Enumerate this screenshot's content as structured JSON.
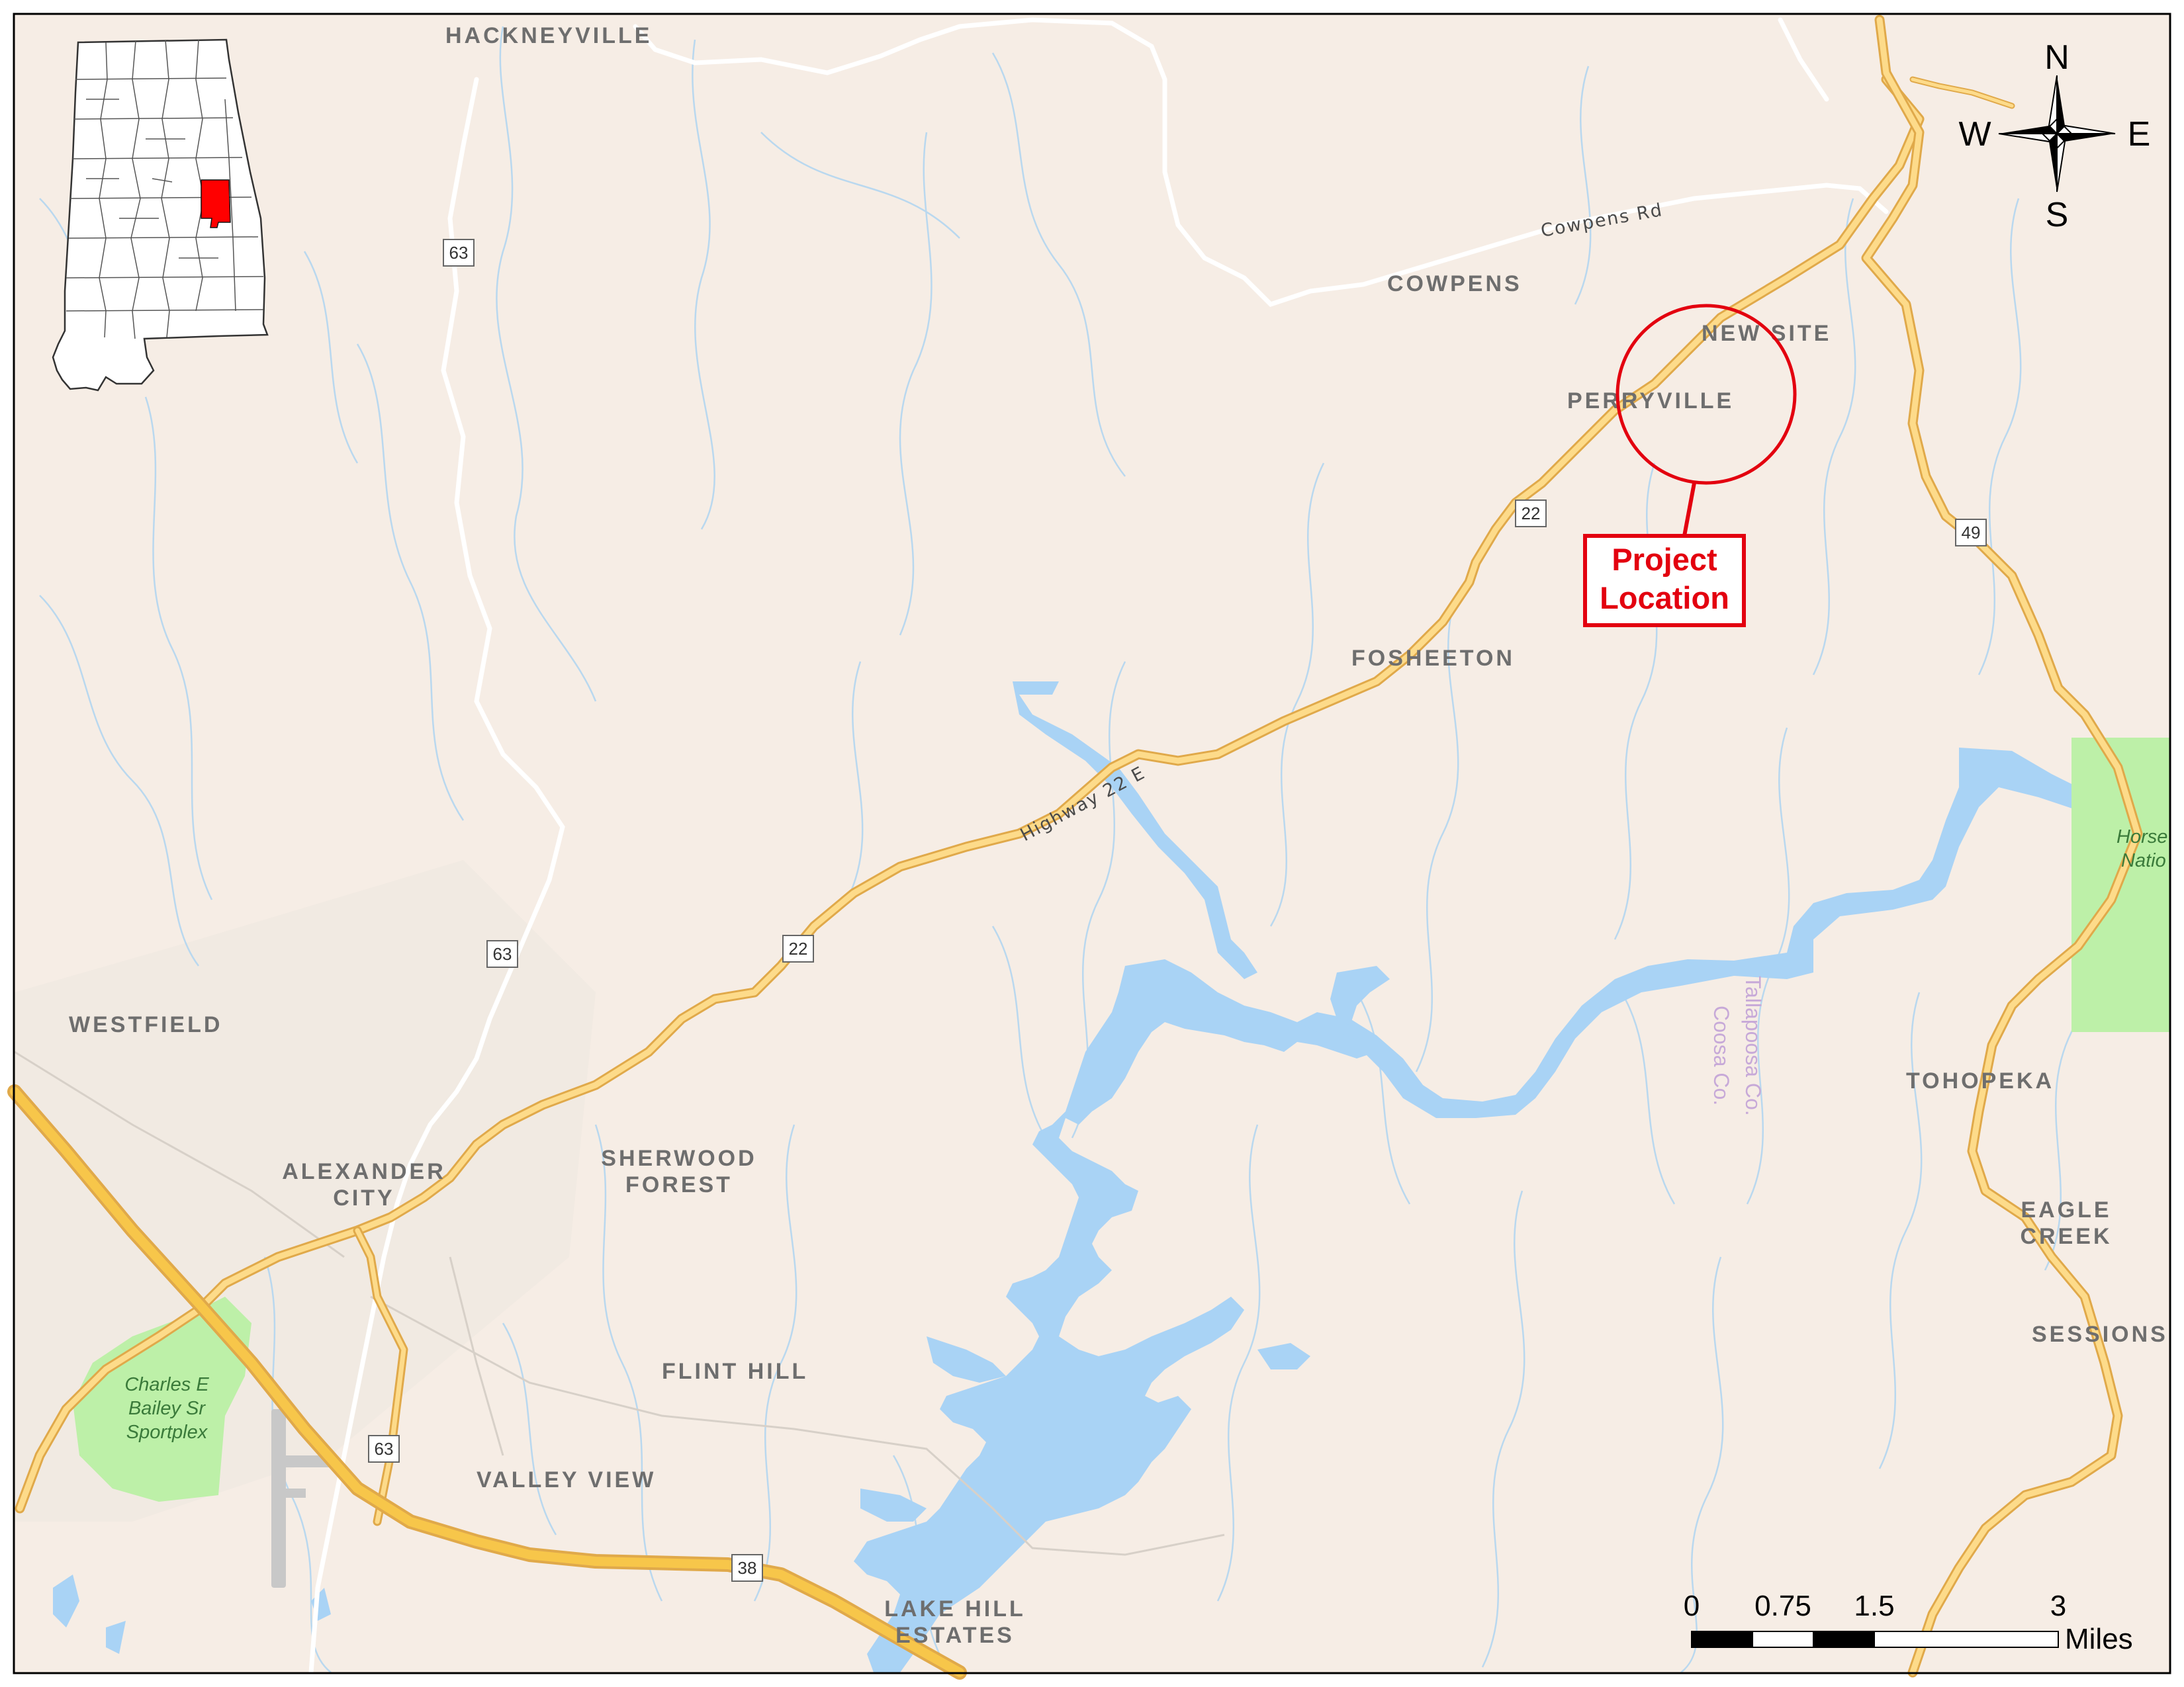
{
  "places": {
    "hackneyville": "HACKNEYVILLE",
    "cowpens": "COWPENS",
    "new_site": "NEW SITE",
    "perryville": "PERRYVILLE",
    "fosheeton": "FOSHEETON",
    "westfield": "WESTFIELD",
    "alexander_city_1": "ALEXANDER",
    "alexander_city_2": "CITY",
    "sherwood_forest_1": "SHERWOOD",
    "sherwood_forest_2": "FOREST",
    "flint_hill": "FLINT HILL",
    "valley_view": "VALLEY VIEW",
    "lake_hill_estates_1": "LAKE HILL",
    "lake_hill_estates_2": "ESTATES",
    "tohopeka": "TOHOPEKA",
    "eagle_creek_1": "EAGLE",
    "eagle_creek_2": "CREEK",
    "sessions": "SESSIONS"
  },
  "roads": {
    "cowpens_rd": "Cowpens Rd",
    "highway_22_e": "Highway 22 E"
  },
  "shields": {
    "r63_a": "63",
    "r63_b": "63",
    "r63_c": "63",
    "r22_a": "22",
    "r22_b": "22",
    "r49": "49",
    "r38": "38"
  },
  "parks": {
    "sportplex_1": "Charles E",
    "sportplex_2": "Bailey Sr",
    "sportplex_3": "Sportplex",
    "horseshoe_1": "Horse",
    "horseshoe_2": "Natio"
  },
  "county": {
    "tallapoosa": "Tallapoosa Co.",
    "coosa": "Coosa Co."
  },
  "callout": {
    "line1": "Project",
    "line2": "Location"
  },
  "compass": {
    "n": "N",
    "s": "S",
    "e": "E",
    "w": "W"
  },
  "scale": {
    "ticks": [
      "0",
      "0.75",
      "1.5",
      "3"
    ],
    "unit": "Miles"
  },
  "colors": {
    "land": "#f6ede5",
    "water": "#a9d3f5",
    "highway": "#f7c64a",
    "park": "#bdf0a8",
    "project_marker": "#e3000f"
  },
  "inset": {
    "state": "Alabama",
    "highlighted_county": "Tallapoosa"
  }
}
